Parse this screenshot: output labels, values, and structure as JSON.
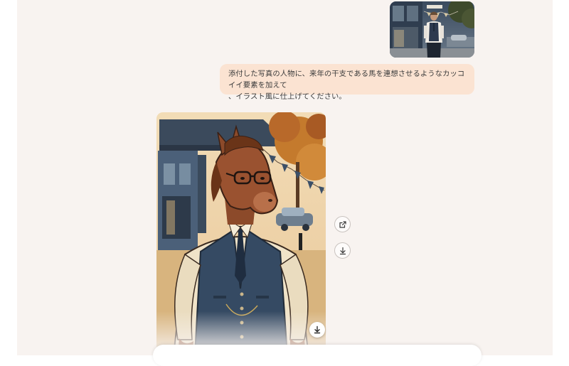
{
  "conversation": {
    "attachment": {
      "icon": "photo-thumbnail"
    },
    "user_message": {
      "line1": "添付した写真の人物に、来年の干支である馬を連想させるようなカッコイイ要素を加えて",
      "line2": "、イラスト風に仕上げてください。"
    },
    "generated_image": {
      "icon": "horse-illustration"
    },
    "actions": {
      "share_icon": "share-icon",
      "download_icon": "download-icon",
      "image_download_icon": "download-icon"
    }
  },
  "colors": {
    "panel_background": "#f8f3f0",
    "user_bubble": "#fbe3d2",
    "text": "#3b3b3b"
  }
}
